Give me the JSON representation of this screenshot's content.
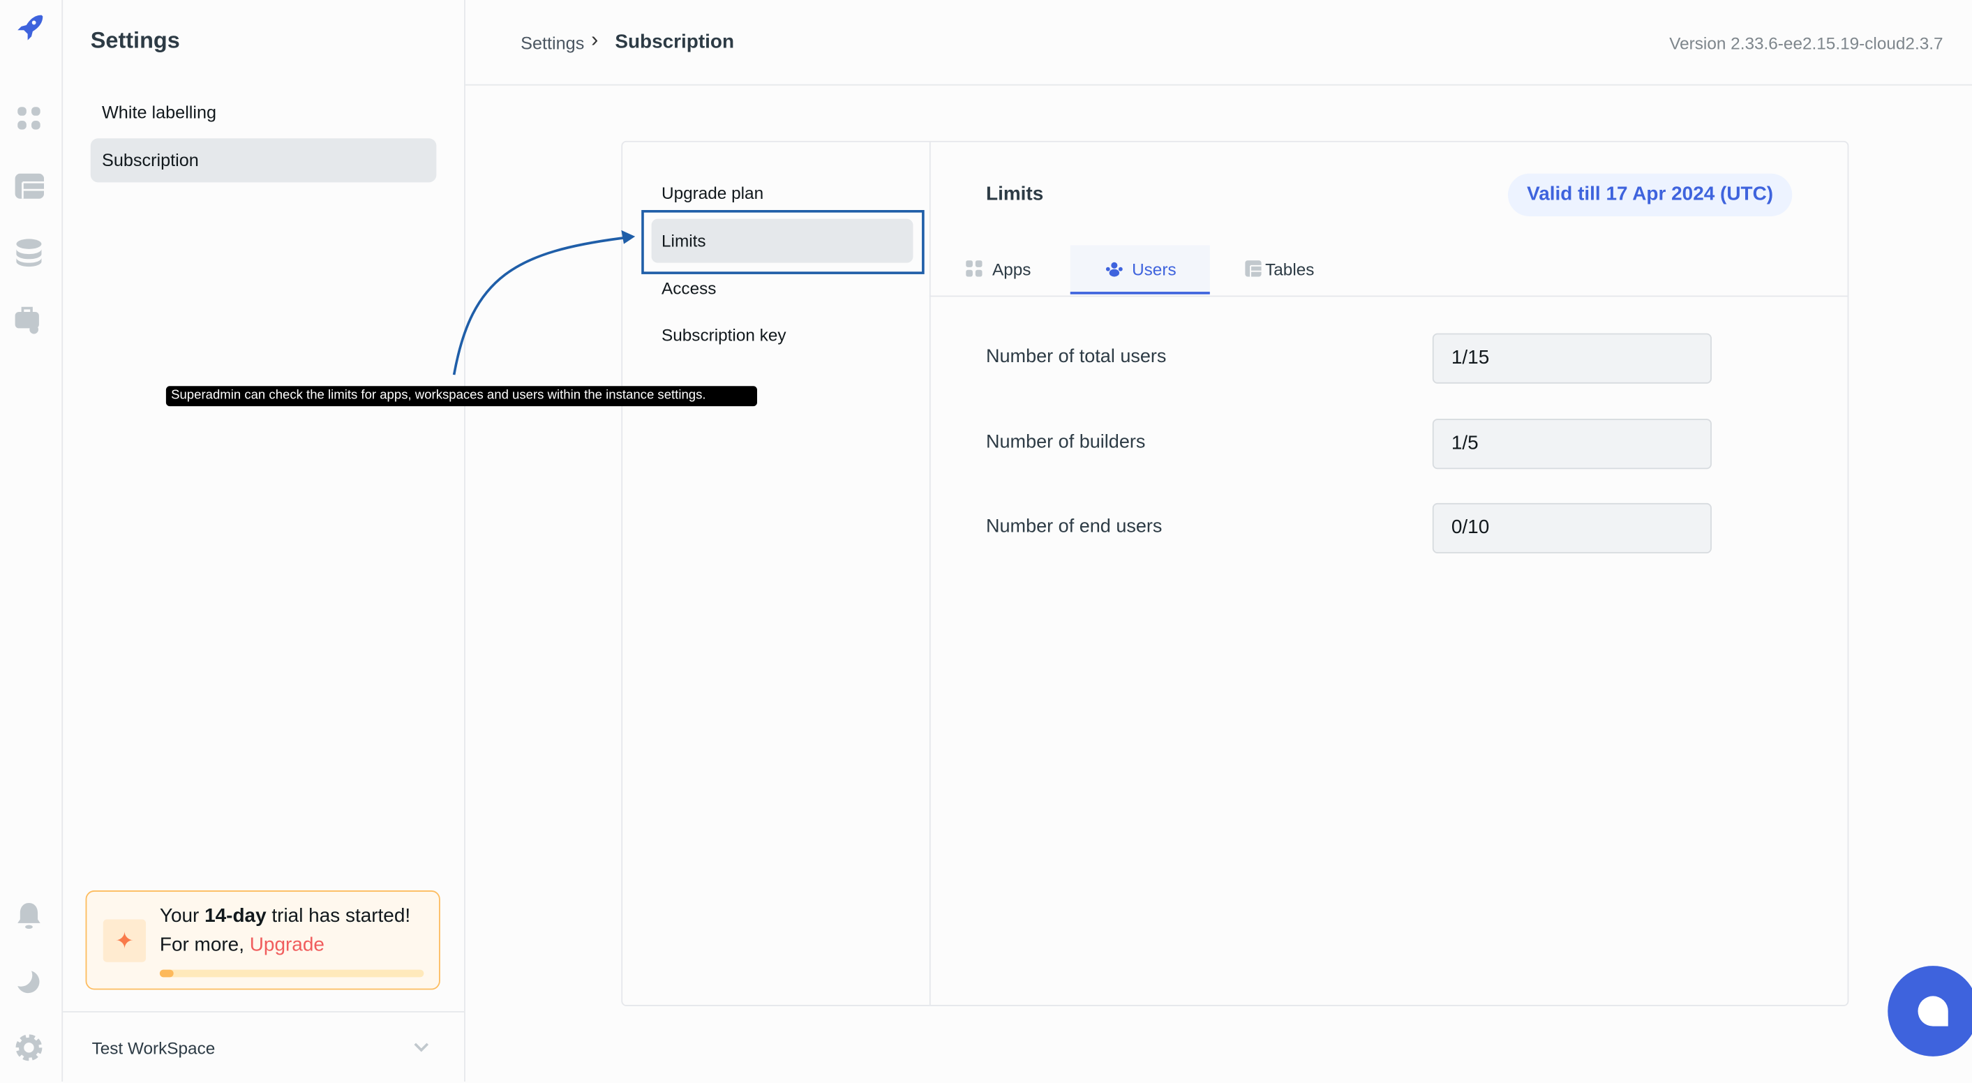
{
  "colors": {
    "accent": "#3e63dd",
    "annotation": "#1f5ea8",
    "trial_border": "#fdbc5f",
    "upgrade": "#f05d5d"
  },
  "rail": {
    "icons": [
      "rocket-logo-icon",
      "apps-grid-icon",
      "tables-icon",
      "database-icon",
      "workflows-icon",
      "bell-icon",
      "moon-icon",
      "gear-icon"
    ]
  },
  "sidebar": {
    "title": "Settings",
    "items": [
      {
        "label": "White labelling"
      },
      {
        "label": "Subscription",
        "active": true
      }
    ],
    "trial": {
      "prefix": "Your ",
      "bold": "14-day",
      "suffix": " trial has started!",
      "line2": "For more, ",
      "link": "Upgrade",
      "progress": 0.05
    },
    "workspace": "Test WorkSpace"
  },
  "header": {
    "breadcrumb": [
      "Settings",
      "Subscription"
    ],
    "separator": "›",
    "version": "Version 2.33.6-ee2.15.19-cloud2.3.7"
  },
  "subscription": {
    "nav": [
      {
        "label": "Upgrade plan"
      },
      {
        "label": "Limits",
        "active": true
      },
      {
        "label": "Access"
      },
      {
        "label": "Subscription key"
      }
    ],
    "title": "Limits",
    "valid_badge": "Valid till 17 Apr 2024 (UTC)",
    "tabs": [
      {
        "label": "Apps",
        "icon": "apps-grid-icon"
      },
      {
        "label": "Users",
        "icon": "users-icon",
        "active": true
      },
      {
        "label": "Tables",
        "icon": "table-icon"
      }
    ],
    "rows": [
      {
        "label": "Number of total users",
        "value": "1/15"
      },
      {
        "label": "Number of builders",
        "value": "1/5"
      },
      {
        "label": "Number of end users",
        "value": "0/10"
      }
    ]
  },
  "annotation": {
    "text": "Superadmin can check the limits for apps, workspaces and users within the instance settings."
  }
}
